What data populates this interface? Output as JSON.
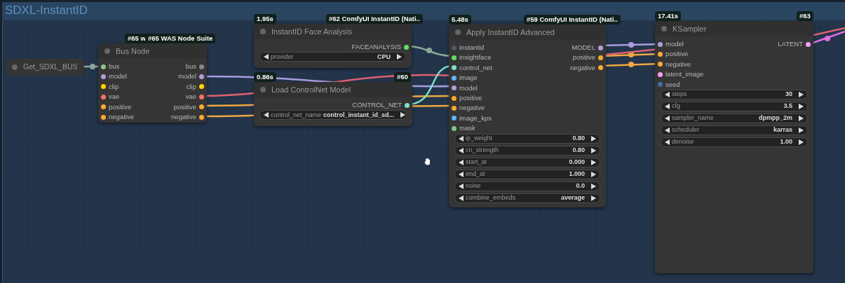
{
  "group": {
    "title": "SDXL-InstantID"
  },
  "nodes": [
    {
      "kind": "getter",
      "title": "Get_SDXL_BUS"
    },
    {
      "kind": "node",
      "title": "Bus Node",
      "badges": [
        "#65 w",
        "#65 WAS Node Suite"
      ],
      "rows": [
        {
          "input": {
            "label": "bus",
            "color": "#8fc48f"
          },
          "output": {
            "label": "bus",
            "color": "#888888"
          }
        },
        {
          "input": {
            "label": "model",
            "color": "#b39ddb"
          },
          "output": {
            "label": "model",
            "color": "#b39ddb"
          }
        },
        {
          "input": {
            "label": "clip",
            "color": "#ffd500"
          },
          "output": {
            "label": "clip",
            "color": "#ffd500"
          }
        },
        {
          "input": {
            "label": "vae",
            "color": "#ff6e6e"
          },
          "output": {
            "label": "vae",
            "color": "#ff6e6e"
          }
        },
        {
          "input": {
            "label": "positive",
            "color": "#ffa931"
          },
          "output": {
            "label": "positive",
            "color": "#ffa931"
          }
        },
        {
          "input": {
            "label": "negative",
            "color": "#ffa931"
          },
          "output": {
            "label": "negative",
            "color": "#ffa931"
          }
        }
      ]
    },
    {
      "kind": "node",
      "title": "InstantID Face Analysis",
      "time": "1.95s",
      "badges": [
        "#62 ComfyUI InstantID (Nati.."
      ],
      "rows": [
        {
          "output": {
            "label": "FACEANALYSIS",
            "color": "#66dd66"
          }
        }
      ],
      "widgets": [
        {
          "label": "provider",
          "value": "CPU"
        }
      ]
    },
    {
      "kind": "node",
      "title": "Load ControlNet Model",
      "time": "0.86s",
      "badges": [
        "#60"
      ],
      "rows": [
        {
          "output": {
            "label": "CONTROL_NET",
            "color": "#7ee0c8"
          }
        }
      ],
      "widgets": [
        {
          "label": "control_net_name",
          "value": "control_instant_id_sd..."
        }
      ]
    },
    {
      "kind": "node",
      "title": "Apply InstantID Advanced",
      "time": "5.48s",
      "badges": [
        "#59 ComfyUI InstantID (Nati.."
      ],
      "rows": [
        {
          "input": {
            "label": "instantid",
            "color": "#555566"
          },
          "output": {
            "label": "MODEL",
            "color": "#b39ddb"
          }
        },
        {
          "input": {
            "label": "insightface",
            "color": "#66dd66"
          },
          "output": {
            "label": "positive",
            "color": "#ffa931"
          }
        },
        {
          "input": {
            "label": "control_net",
            "color": "#7ee0c8"
          },
          "output": {
            "label": "negative",
            "color": "#ffa931"
          }
        },
        {
          "input": {
            "label": "image",
            "color": "#64b5f6"
          }
        },
        {
          "input": {
            "label": "model",
            "color": "#b39ddb"
          }
        },
        {
          "input": {
            "label": "positive",
            "color": "#ffa931"
          }
        },
        {
          "input": {
            "label": "negative",
            "color": "#ffa931"
          }
        },
        {
          "input": {
            "label": "image_kps",
            "color": "#64b5f6"
          }
        },
        {
          "input": {
            "label": "mask",
            "color": "#81c784"
          }
        }
      ],
      "widgets": [
        {
          "label": "ip_weight",
          "value": "0.80"
        },
        {
          "label": "cn_strength",
          "value": "0.80"
        },
        {
          "label": "start_at",
          "value": "0.000"
        },
        {
          "label": "end_at",
          "value": "1.000"
        },
        {
          "label": "noise",
          "value": "0.0"
        },
        {
          "label": "combine_embeds",
          "value": "average"
        }
      ]
    },
    {
      "kind": "node",
      "title": "KSampler",
      "time": "17.41s",
      "badges": [
        "#63"
      ],
      "rows": [
        {
          "input": {
            "label": "model",
            "color": "#b39ddb"
          },
          "output": {
            "label": "LATENT",
            "color": "#ff9cf9"
          }
        },
        {
          "input": {
            "label": "positive",
            "color": "#ffa931"
          }
        },
        {
          "input": {
            "label": "negative",
            "color": "#ffa931"
          }
        },
        {
          "input": {
            "label": "latent_image",
            "color": "#ff9cf9"
          }
        },
        {
          "input": {
            "label": "seed",
            "color": "#3d6fa8"
          }
        }
      ],
      "widgets": [
        {
          "label": "steps",
          "value": "30"
        },
        {
          "label": "cfg",
          "value": "3.5"
        },
        {
          "label": "sampler_name",
          "value": "dpmpp_2m"
        },
        {
          "label": "scheduler",
          "value": "karras"
        },
        {
          "label": "denoise",
          "value": "1.00"
        }
      ]
    }
  ]
}
